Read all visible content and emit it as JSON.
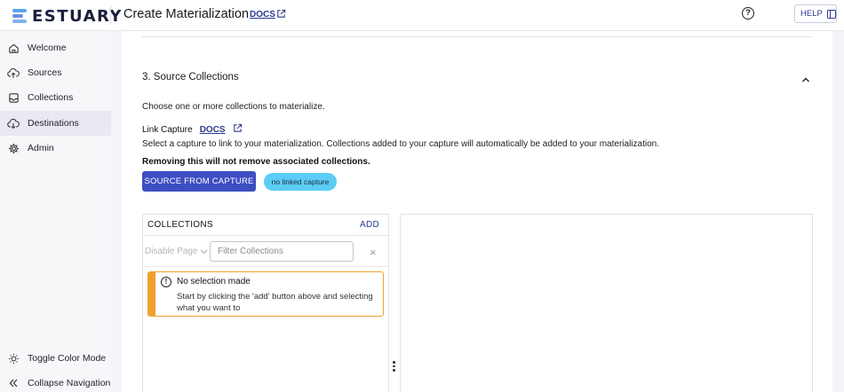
{
  "header": {
    "logo_text": "ESTUARY",
    "title": "Create Materialization",
    "docs_label": "DOCS",
    "help_label": "HELP"
  },
  "sidebar": {
    "items": [
      {
        "label": "Welcome",
        "icon": "home-icon"
      },
      {
        "label": "Sources",
        "icon": "cloud-upload-icon"
      },
      {
        "label": "Collections",
        "icon": "inbox-icon"
      },
      {
        "label": "Destinations",
        "icon": "cloud-download-icon",
        "active": true
      },
      {
        "label": "Admin",
        "icon": "gear-icon"
      }
    ],
    "bottom": [
      {
        "label": "Toggle Color Mode",
        "icon": "sun-icon"
      },
      {
        "label": "Collapse Navigation",
        "icon": "chevrons-left-icon"
      }
    ]
  },
  "section": {
    "title": "3. Source Collections",
    "description": "Choose one or more collections to materialize.",
    "link_capture_label": "Link Capture",
    "link_capture_docs": "DOCS",
    "select_text": "Select a capture to link to your materialization. Collections added to your capture will automatically be added to your materialization.",
    "warning_text": "Removing this will not remove associated collections.",
    "source_button": "SOURCE FROM CAPTURE",
    "chip_label": "no linked capture"
  },
  "collections": {
    "title": "COLLECTIONS",
    "add_label": "ADD",
    "disable_page_label": "Disable Page",
    "filter_placeholder": "Filter Collections",
    "alert": {
      "title": "No selection made",
      "body": "Start by clicking the 'add' button above and selecting what you want to"
    }
  },
  "colors": {
    "accent": "#3d4ec2",
    "chip": "#5ccdf4",
    "warning": "#f0a12d"
  }
}
